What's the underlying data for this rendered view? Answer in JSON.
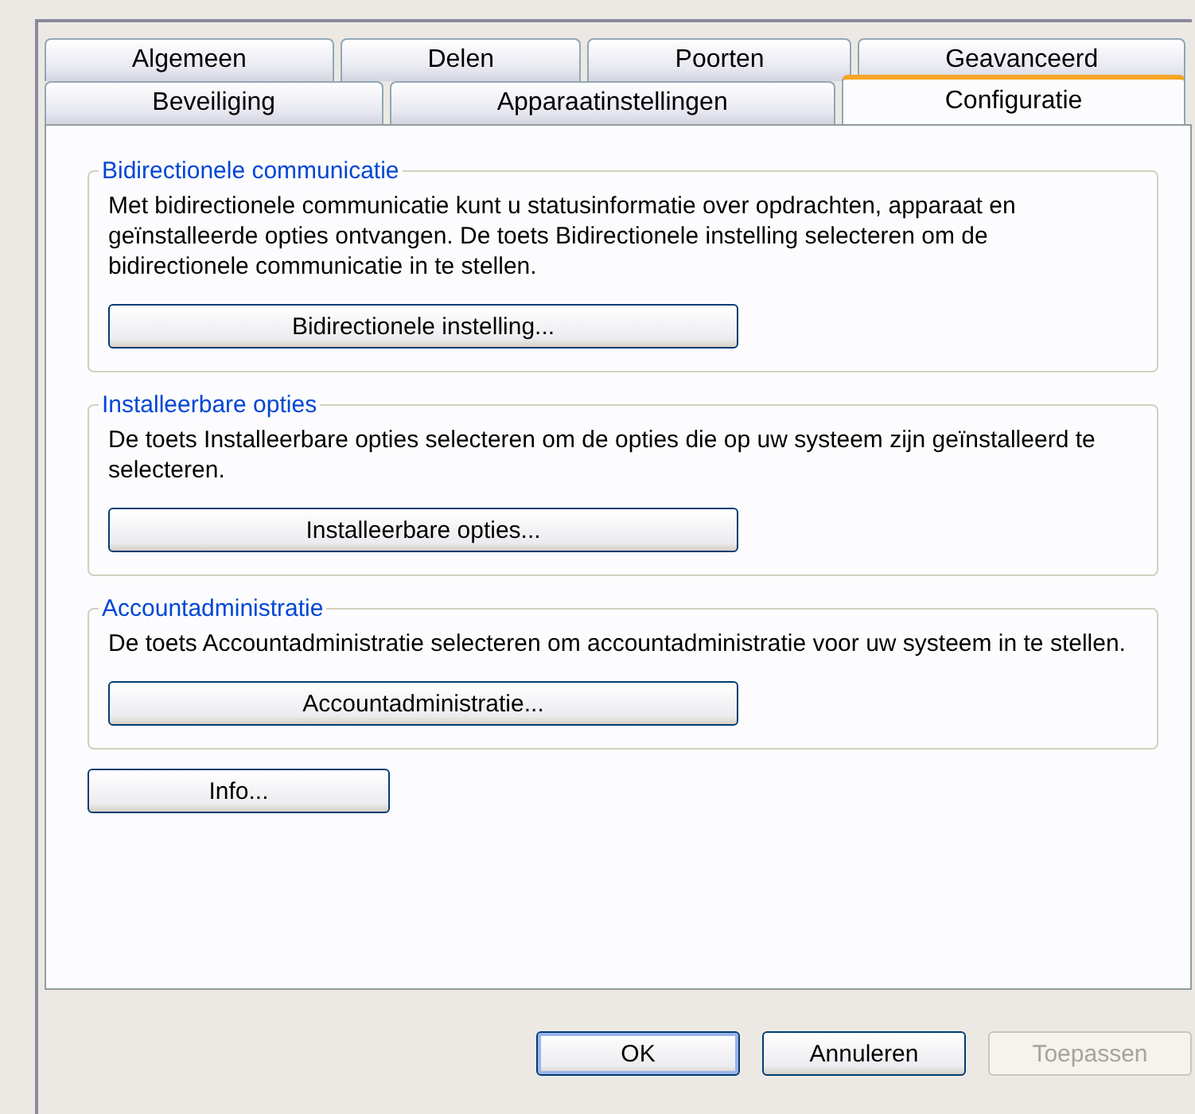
{
  "tab_rows": [
    [
      {
        "label": "Algemeen",
        "selected": false
      },
      {
        "label": "Delen",
        "selected": false
      },
      {
        "label": "Poorten",
        "selected": false
      },
      {
        "label": "Geavanceerd",
        "selected": false
      }
    ],
    [
      {
        "label": "Beveiliging",
        "selected": false
      },
      {
        "label": "Apparaatinstellingen",
        "selected": false
      },
      {
        "label": "Configuratie",
        "selected": true
      }
    ]
  ],
  "groups": [
    {
      "title": "Bidirectionele communicatie",
      "text": "Met bidirectionele communicatie kunt u statusinformatie over opdrachten, apparaat en geïnstalleerde opties ontvangen. De toets Bidirectionele instelling selecteren om de bidirectionele communicatie in te stellen.",
      "button": "Bidirectionele instelling..."
    },
    {
      "title": "Installeerbare opties",
      "text": "De toets Installeerbare opties selecteren om de opties die op uw systeem zijn geïnstalleerd te selecteren.",
      "button": "Installeerbare opties..."
    },
    {
      "title": "Accountadministratie",
      "text": "De toets Accountadministratie selecteren om accountadministratie voor uw systeem in te stellen.",
      "button": "Accountadministratie..."
    }
  ],
  "info_button": "Info...",
  "buttons": [
    {
      "label": "OK",
      "default": true,
      "disabled": false
    },
    {
      "label": "Annuleren",
      "default": false,
      "disabled": false
    },
    {
      "label": "Toepassen",
      "default": false,
      "disabled": true
    }
  ]
}
